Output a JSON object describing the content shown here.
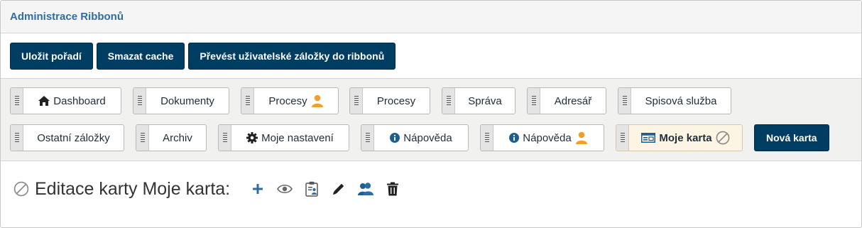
{
  "header": {
    "title": "Administrace Ribbonů"
  },
  "toolbar": {
    "save_order": "Uložit pořadí",
    "clear_cache": "Smazat cache",
    "convert_tabs": "Převést uživatelské záložky do ribbonů"
  },
  "tabs_row1": [
    {
      "label": "Dashboard",
      "icon": "home-icon"
    },
    {
      "label": "Dokumenty"
    },
    {
      "label": "Procesy",
      "icon_after": "user-icon"
    },
    {
      "label": "Procesy"
    },
    {
      "label": "Správa"
    },
    {
      "label": "Adresář"
    },
    {
      "label": "Spisová služba"
    }
  ],
  "tabs_row2": [
    {
      "label": "Ostatní záložky"
    },
    {
      "label": "Archiv"
    },
    {
      "label": "Moje nastavení",
      "icon": "gear-icon"
    },
    {
      "label": "Nápověda",
      "icon": "info-icon"
    },
    {
      "label": "Nápověda",
      "icon": "info-icon",
      "icon_after": "user-icon"
    },
    {
      "label": "Moje karta",
      "icon": "card-icon",
      "icon_after": "disabled-icon",
      "active": true
    }
  ],
  "new_tab_label": "Nová karta",
  "editor": {
    "title": "Editace karty Moje karta:",
    "tools": [
      "add-icon",
      "eye-icon",
      "clipboard-user-icon",
      "pencil-icon",
      "user-group-icon",
      "trash-icon"
    ]
  },
  "colors": {
    "primary": "#003d63",
    "title_blue": "#2d6da3",
    "user_orange": "#f0a02a",
    "active_tab_bg": "#fdf5e4"
  }
}
